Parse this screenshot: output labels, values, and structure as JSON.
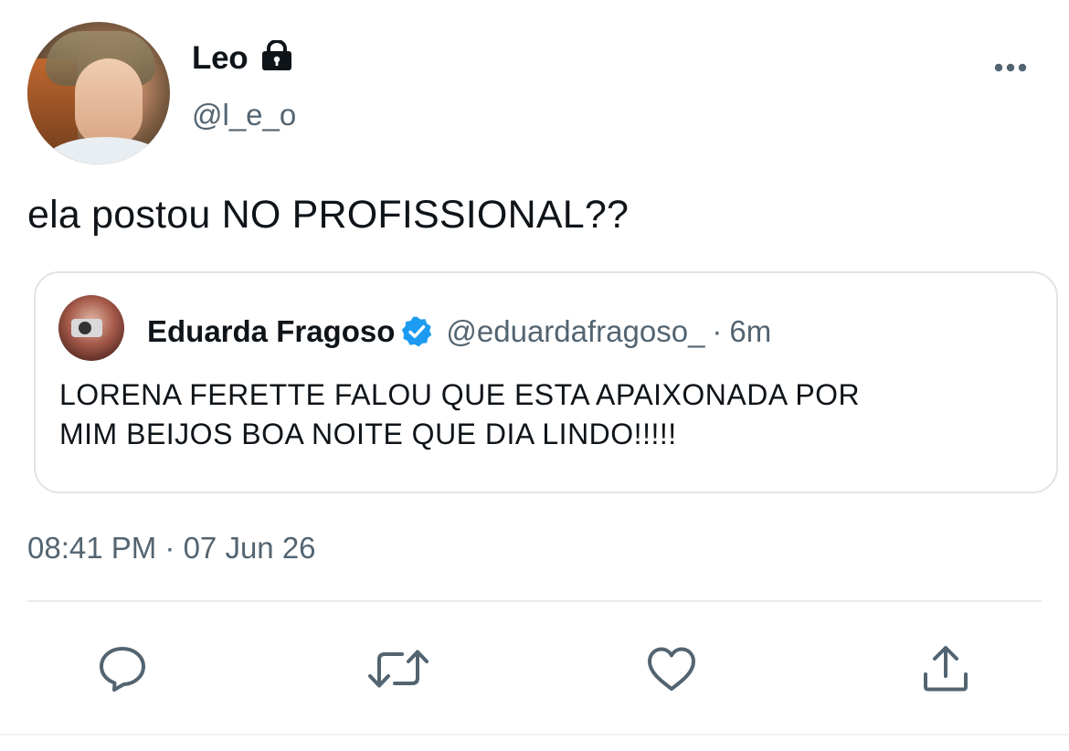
{
  "author": {
    "display_name": "Leo",
    "handle": "@l_e_o",
    "protected": true
  },
  "tweet": {
    "text": "ela postou NO PROFISSIONAL??",
    "timestamp": "08:41 PM · 07 Jun 26"
  },
  "quoted_tweet": {
    "display_name": "Eduarda Fragoso",
    "verified": true,
    "handle": "@eduardafragoso_",
    "separator": "·",
    "time": "6m",
    "text_line1": "LORENA FERETTE FALOU QUE ESTA APAIXONADA POR",
    "text_line2": "MIM BEIJOS BOA NOITE QUE DIA LINDO!!!!!"
  },
  "actions": [
    {
      "icon": "reply-icon"
    },
    {
      "icon": "retweet-icon"
    },
    {
      "icon": "like-icon"
    },
    {
      "icon": "share-icon"
    }
  ],
  "colors": {
    "text": "#0f1419",
    "secondary": "#536471",
    "verified": "#1d9bf0",
    "border": "#dfe4e8"
  }
}
